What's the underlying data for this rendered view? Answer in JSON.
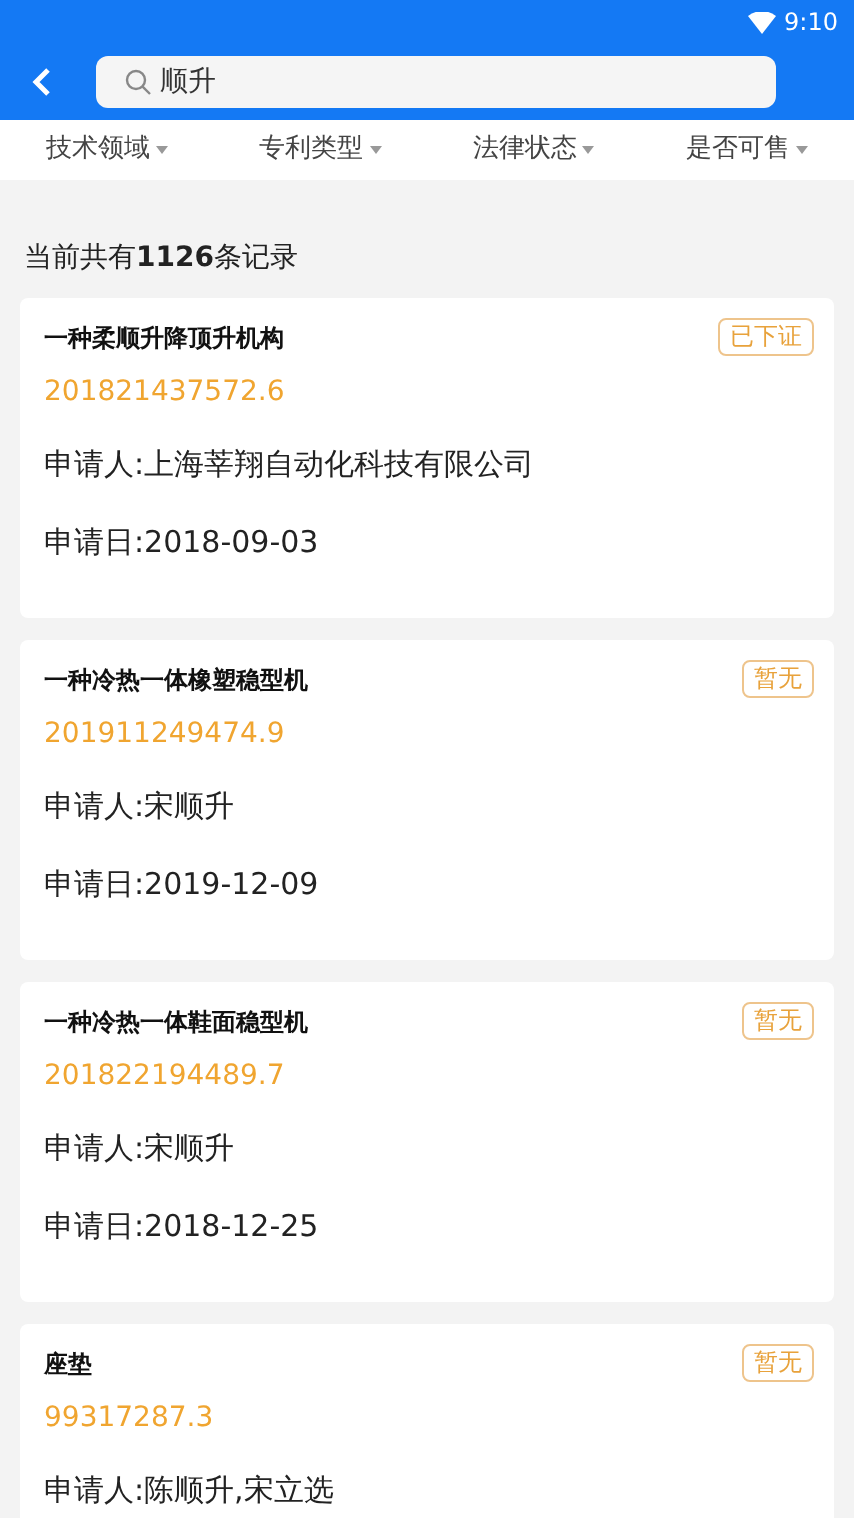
{
  "status_bar": {
    "time": "9:10"
  },
  "search": {
    "value": "顺升"
  },
  "filters": [
    {
      "label": "技术领域"
    },
    {
      "label": "专利类型"
    },
    {
      "label": "法律状态"
    },
    {
      "label": "是否可售"
    }
  ],
  "summary": "当前共有**1126**条记录",
  "results": [
    {
      "title": "一种柔顺升降顶升机构",
      "badge": "已下证",
      "number": "201821437572.6",
      "applicant": "申请人:上海莘翔自动化科技有限公司",
      "date": "申请日:2018-09-03"
    },
    {
      "title": "一种冷热一体橡塑稳型机",
      "badge": "暂无",
      "number": "201911249474.9",
      "applicant": "申请人:宋顺升",
      "date": "申请日:2019-12-09"
    },
    {
      "title": "一种冷热一体鞋面稳型机",
      "badge": "暂无",
      "number": "201822194489.7",
      "applicant": "申请人:宋顺升",
      "date": "申请日:2018-12-25"
    },
    {
      "title": "座垫",
      "badge": "暂无",
      "number": "99317287.3",
      "applicant": "申请人:陈顺升,宋立选"
    }
  ]
}
